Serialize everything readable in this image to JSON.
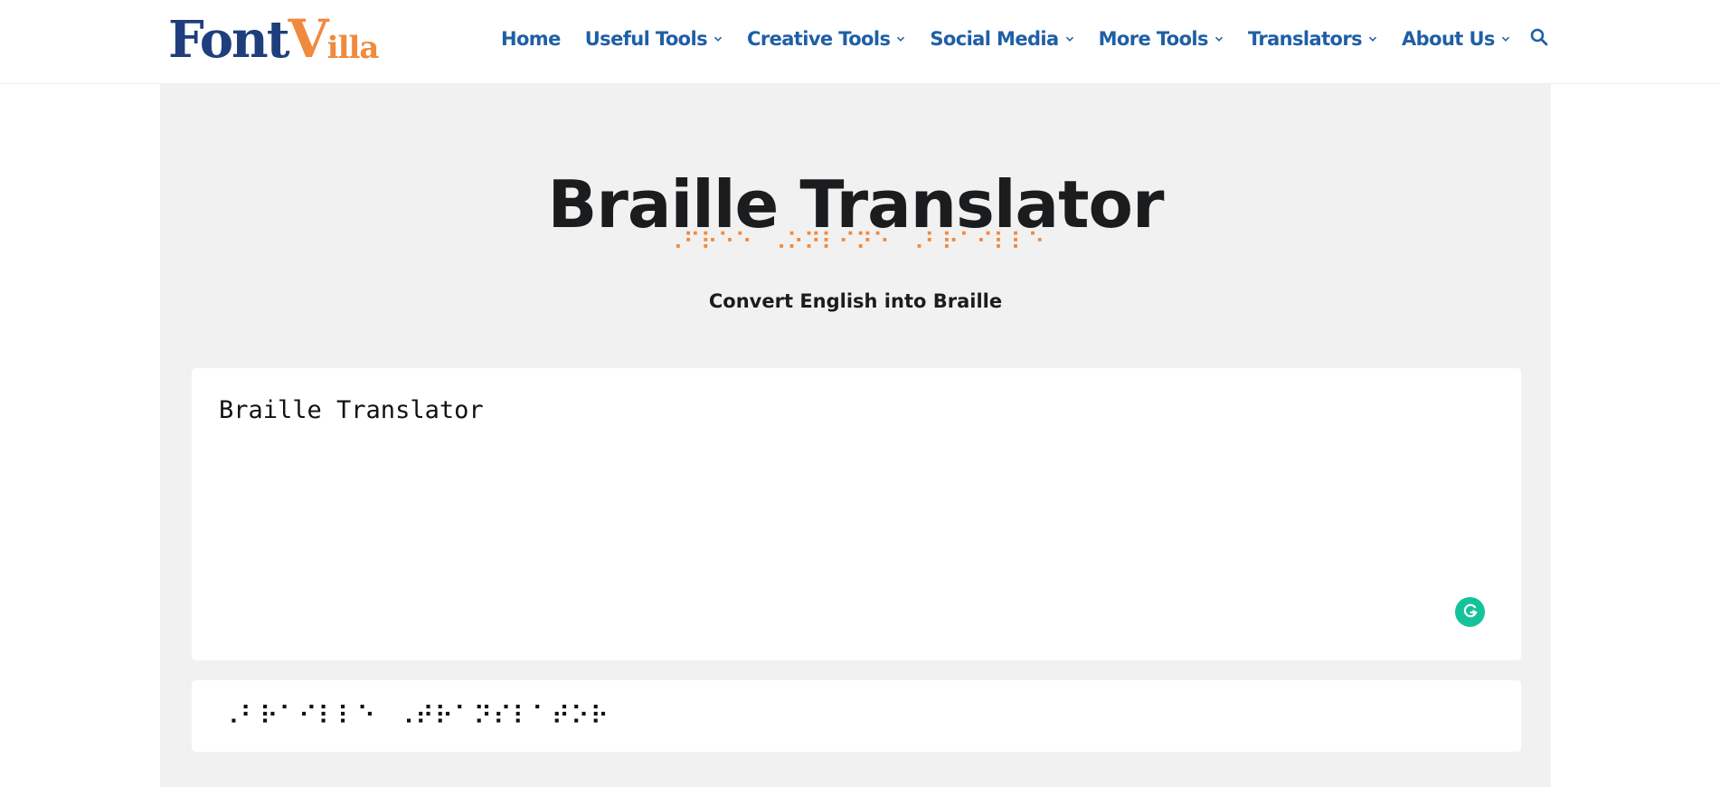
{
  "logo": {
    "part1": "Font",
    "part2_cap": "V",
    "part2_rest": "illa"
  },
  "nav": {
    "items": [
      {
        "label": "Home",
        "has_dropdown": false
      },
      {
        "label": "Useful Tools",
        "has_dropdown": true
      },
      {
        "label": "Creative Tools",
        "has_dropdown": true
      },
      {
        "label": "Social Media",
        "has_dropdown": true
      },
      {
        "label": "More Tools",
        "has_dropdown": true
      },
      {
        "label": "Translators",
        "has_dropdown": true
      },
      {
        "label": "About Us",
        "has_dropdown": true
      }
    ],
    "search_icon": "search-icon"
  },
  "page": {
    "title": "Braille Translator",
    "braille_tagline": "⠠⠋⠗⠑⠑⠀⠠⠕⠝⠇⠊⠝⠑⠀⠠⠃⠗⠁⠊⠇⠇⠑",
    "subtitle": "Convert English into Braille"
  },
  "translator": {
    "input_value": "Braille Translator",
    "output_value": "⠠⠃⠗⠁⠊⠇⠇⠑⠀⠠⠞⠗⠁⠝⠎⠇⠁⠞⠕⠗"
  },
  "colors": {
    "nav_text": "#1f5fa6",
    "logo_blue": "#1f3e7d",
    "accent_orange": "#f08a3e",
    "panel_bg": "#f1f1f1",
    "grammarly_green": "#15c39a"
  }
}
